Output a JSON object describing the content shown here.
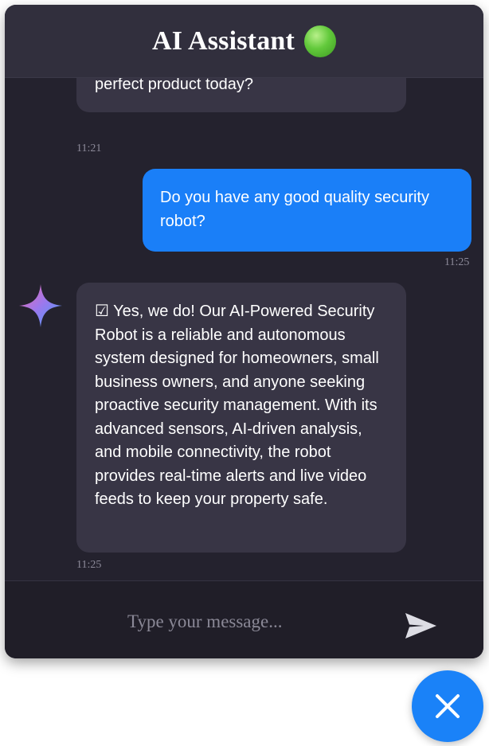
{
  "header": {
    "title": "AI Assistant",
    "status_icon": "green-circle-icon",
    "status_color": "#4caf2a"
  },
  "messages": [
    {
      "sender": "bot",
      "text": "assistant. How can I help you find the perfect product today?",
      "time": "11:21"
    },
    {
      "sender": "user",
      "text": "Do you have any good quality security robot?",
      "time": "11:25"
    },
    {
      "sender": "bot",
      "avatar_icon": "sparkle-icon",
      "text": "☑ Yes, we do! Our AI-Powered Security Robot is a reliable and autonomous system designed for homeowners, small business owners, and anyone seeking proactive security management. With its advanced sensors, AI-driven analysis, and mobile connectivity, the robot provides real-time alerts and live video feeds to keep your property safe.",
      "time": "11:25"
    }
  ],
  "composer": {
    "placeholder": "Type your message...",
    "value": "",
    "send_icon": "send-icon"
  },
  "fab": {
    "icon": "close-icon",
    "color": "#1a82f8"
  },
  "colors": {
    "panel_bg": "#24222e",
    "header_bg": "#312f3d",
    "bot_bubble": "#383545",
    "user_bubble": "#1a7ff8"
  }
}
